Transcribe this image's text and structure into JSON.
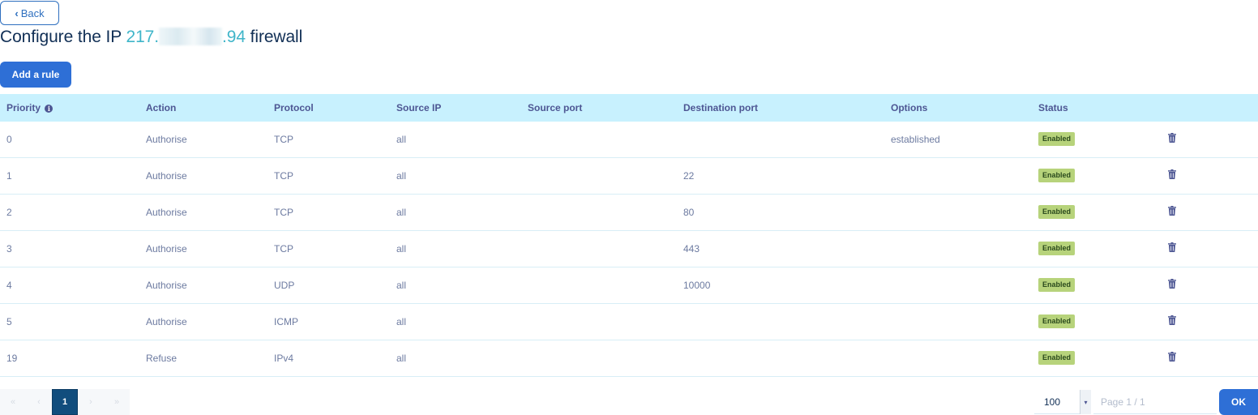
{
  "back_button": {
    "label": "Back"
  },
  "title": {
    "prefix": "Configure the IP ",
    "ip_start": "217.",
    "ip_end": ".94",
    "suffix": " firewall"
  },
  "add_button": {
    "label": "Add a rule"
  },
  "table": {
    "headers": {
      "priority": "Priority",
      "action": "Action",
      "protocol": "Protocol",
      "source_ip": "Source IP",
      "source_port": "Source port",
      "destination_port": "Destination port",
      "options": "Options",
      "status": "Status"
    },
    "rows": [
      {
        "priority": "0",
        "action": "Authorise",
        "protocol": "TCP",
        "source_ip": "all",
        "source_port": "",
        "destination_port": "",
        "options": "established",
        "status": "Enabled"
      },
      {
        "priority": "1",
        "action": "Authorise",
        "protocol": "TCP",
        "source_ip": "all",
        "source_port": "",
        "destination_port": "22",
        "options": "",
        "status": "Enabled"
      },
      {
        "priority": "2",
        "action": "Authorise",
        "protocol": "TCP",
        "source_ip": "all",
        "source_port": "",
        "destination_port": "80",
        "options": "",
        "status": "Enabled"
      },
      {
        "priority": "3",
        "action": "Authorise",
        "protocol": "TCP",
        "source_ip": "all",
        "source_port": "",
        "destination_port": "443",
        "options": "",
        "status": "Enabled"
      },
      {
        "priority": "4",
        "action": "Authorise",
        "protocol": "UDP",
        "source_ip": "all",
        "source_port": "",
        "destination_port": "10000",
        "options": "",
        "status": "Enabled"
      },
      {
        "priority": "5",
        "action": "Authorise",
        "protocol": "ICMP",
        "source_ip": "all",
        "source_port": "",
        "destination_port": "",
        "options": "",
        "status": "Enabled"
      },
      {
        "priority": "19",
        "action": "Refuse",
        "protocol": "IPv4",
        "source_ip": "all",
        "source_port": "",
        "destination_port": "",
        "options": "",
        "status": "Enabled"
      }
    ]
  },
  "pagination": {
    "first": "«",
    "prev": "‹",
    "current": "1",
    "next": "›",
    "last": "»",
    "per_page": "100",
    "page_placeholder": "Page 1 / 1",
    "ok_label": "OK"
  },
  "icons": {
    "back": "chevron-left-icon",
    "priority_info": "info-icon",
    "row_delete": "trash-icon",
    "per_page_caret": "caret-down-icon"
  },
  "colors": {
    "primary": "#2e6fd6",
    "header_bg": "#c8f1fe",
    "ip_accent": "#3fb5c9",
    "badge_bg": "#b7d37b",
    "active_page": "#114d7d"
  }
}
